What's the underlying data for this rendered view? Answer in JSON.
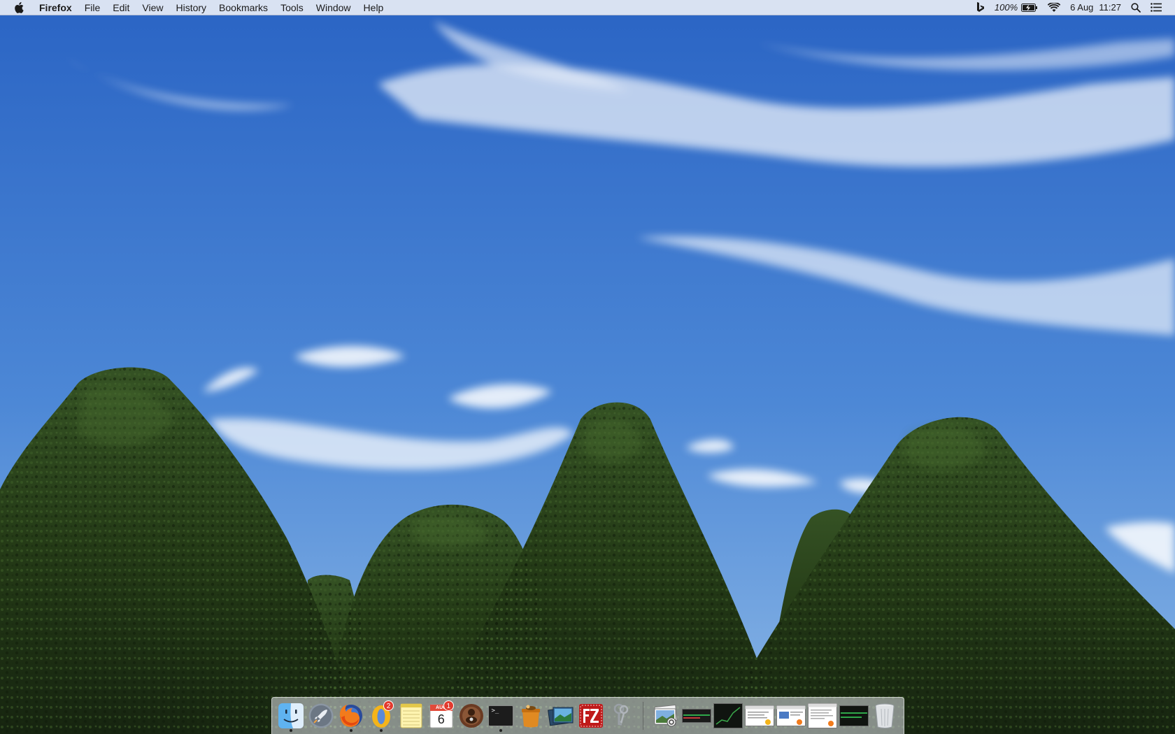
{
  "menubar": {
    "app_name": "Firefox",
    "menus": [
      "File",
      "Edit",
      "View",
      "History",
      "Bookmarks",
      "Tools",
      "Window",
      "Help"
    ],
    "status": {
      "battery_percent": "100%",
      "date": "6 Aug",
      "time": "11:27"
    }
  },
  "dock": {
    "apps": [
      {
        "name": "Finder",
        "icon": "finder-icon",
        "running": true
      },
      {
        "name": "Launchpad",
        "icon": "rocket-icon",
        "running": false
      },
      {
        "name": "Firefox",
        "icon": "firefox-icon",
        "running": true
      },
      {
        "name": "Opera",
        "icon": "opera-icon",
        "running": true,
        "badge": "2"
      },
      {
        "name": "Notes",
        "icon": "notes-icon",
        "running": false
      },
      {
        "name": "Calendar",
        "icon": "calendar-icon",
        "running": false,
        "badge": "1",
        "month": "AUG",
        "day": "6"
      },
      {
        "name": "Photo Booth",
        "icon": "webcam-icon",
        "running": false
      },
      {
        "name": "Terminal",
        "icon": "terminal-icon",
        "running": true,
        "prompt": ">_"
      },
      {
        "name": "Pot",
        "icon": "pot-icon",
        "running": false
      },
      {
        "name": "Preview",
        "icon": "screens-icon",
        "running": false
      },
      {
        "name": "FileZilla",
        "icon": "filezilla-icon",
        "running": false
      },
      {
        "name": "Keychain",
        "icon": "keys-icon",
        "running": false
      }
    ],
    "minimized": [
      {
        "name": "Photos folder",
        "icon": "photos-stack-icon"
      },
      {
        "name": "Window 1",
        "icon": "window-thumb-icon"
      },
      {
        "name": "Window 2",
        "icon": "window-thumb-icon"
      },
      {
        "name": "Window 3",
        "icon": "window-thumb-icon"
      },
      {
        "name": "Window 4",
        "icon": "window-thumb-icon"
      },
      {
        "name": "Window 5",
        "icon": "window-thumb-icon"
      },
      {
        "name": "Window 6",
        "icon": "window-thumb-icon"
      }
    ],
    "trash": {
      "name": "Trash",
      "icon": "trash-icon"
    }
  },
  "colors": {
    "sky_top": "#1f5fc0",
    "sky_bottom": "#78a8e0",
    "hedge_dark": "#1d2e12",
    "hedge_mid": "#2f4a1c"
  }
}
